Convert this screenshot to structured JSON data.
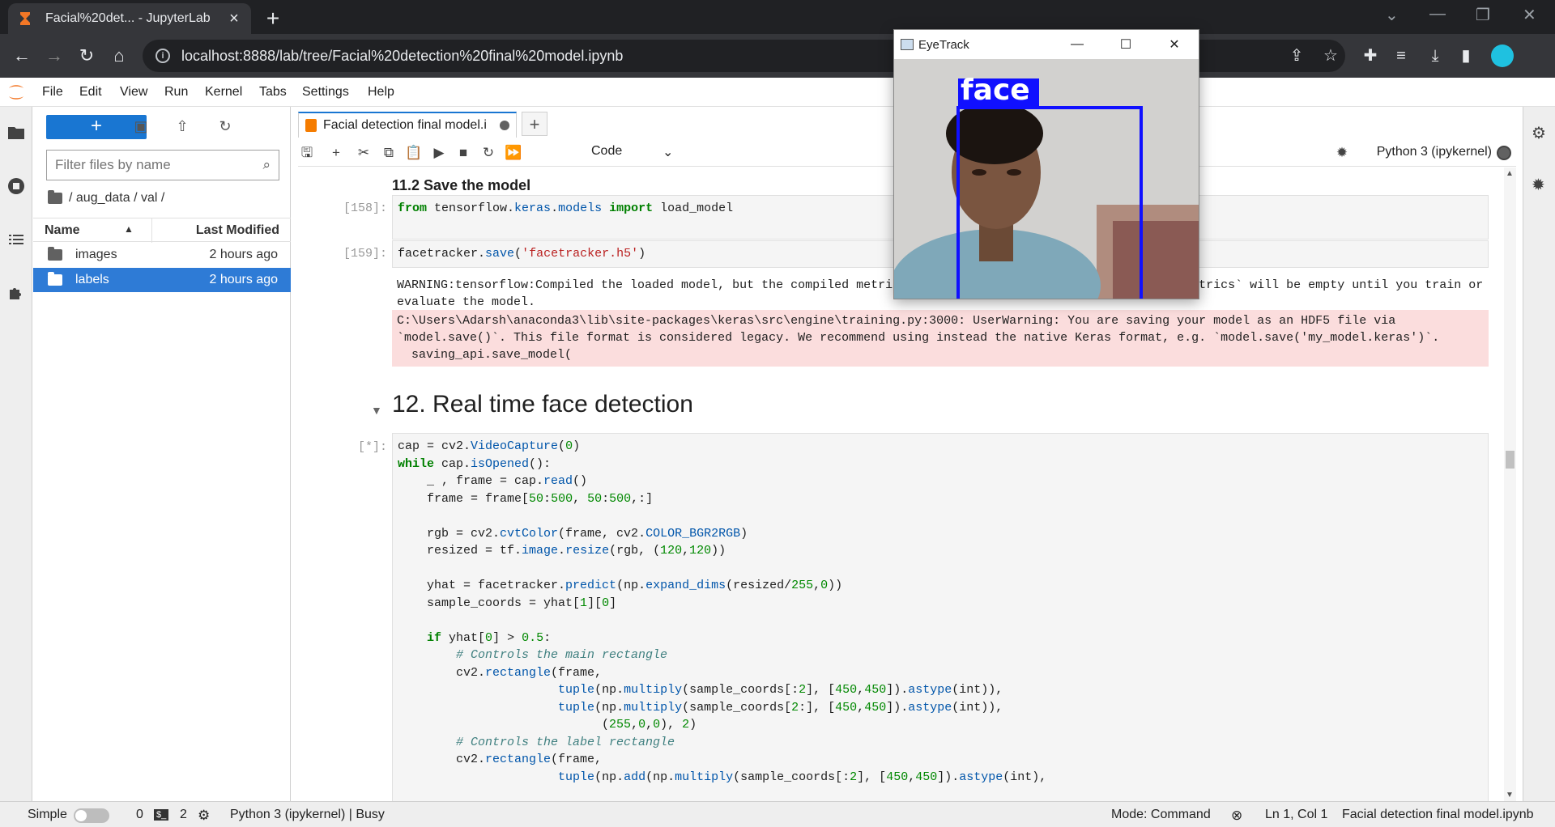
{
  "browser": {
    "tab_title": "Facial%20det... - JupyterLab",
    "url": "localhost:8888/lab/tree/Facial%20detection%20final%20model.ipynb"
  },
  "menu": [
    "File",
    "Edit",
    "View",
    "Run",
    "Kernel",
    "Tabs",
    "Settings",
    "Help"
  ],
  "filebrowser": {
    "filter_placeholder": "Filter files by name",
    "breadcrumb": "/ aug_data / val /",
    "col_name": "Name",
    "col_modified": "Last Modified",
    "rows": [
      {
        "name": "images",
        "modified": "2 hours ago",
        "selected": false
      },
      {
        "name": "labels",
        "modified": "2 hours ago",
        "selected": true
      }
    ]
  },
  "notebook": {
    "tab_title": "Facial detection final model.i",
    "cell_type": "Code",
    "kernel": "Python 3 (ipykernel)",
    "heading_save": "11.2 Save the model",
    "prompt_158": "[158]:",
    "prompt_159": "[159]:",
    "prompt_busy": "[*]:",
    "warning": "WARNING:tensorflow:Compiled the loaded model, but the compiled metrics have yet to be built. `model.compile_metrics` will be empty until you train or evaluate the model.",
    "error": "C:\\Users\\Adarsh\\anaconda3\\lib\\site-packages\\keras\\src\\engine\\training.py:3000: UserWarning: You are saving your model as an HDF5 file via `model.save()`. This file format is considered legacy. We recommend using instead the native Keras format, e.g. `model.save('my_model.keras')`.\n  saving_api.save_model(",
    "heading_realtime": "12. Real time face detection"
  },
  "eyetrack": {
    "title": "EyeTrack",
    "label": "face"
  },
  "status": {
    "mode_simple": "Simple",
    "zero": "0",
    "terminals": "2",
    "kernel_status": "Python 3 (ipykernel) | Busy",
    "mode": "Mode: Command",
    "position": "Ln 1, Col 1",
    "filename": "Facial detection final model.ipynb"
  }
}
